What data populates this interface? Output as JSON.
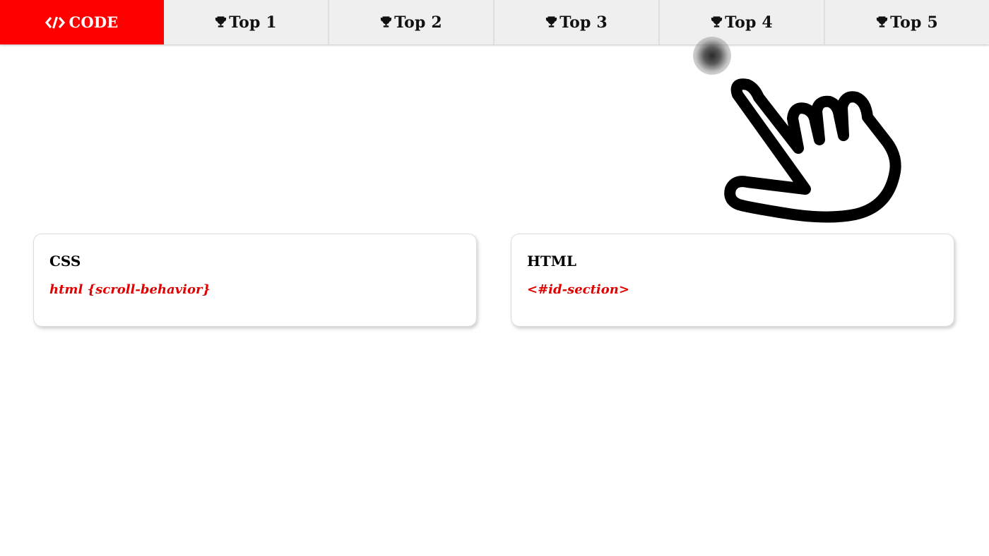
{
  "nav": {
    "brand": {
      "label": "CODE",
      "icon": "code-icon",
      "color": "#ff0000"
    },
    "items": [
      {
        "label": "Top 1",
        "icon": "trophy-icon"
      },
      {
        "label": "Top 2",
        "icon": "trophy-icon"
      },
      {
        "label": "Top 3",
        "icon": "trophy-icon"
      },
      {
        "label": "Top 4",
        "icon": "trophy-icon"
      },
      {
        "label": "Top 5",
        "icon": "trophy-icon"
      }
    ]
  },
  "cards": [
    {
      "title": "CSS",
      "code": "html {scroll-behavior}"
    },
    {
      "title": "HTML",
      "code": "<#id-section>"
    }
  ],
  "overlay": {
    "pointer_icon": "hand-pointer-icon",
    "tap_indicator": "tap-dot"
  },
  "colors": {
    "accent": "#ff0000",
    "code_text": "#e00000",
    "nav_bg": "#efefef"
  }
}
